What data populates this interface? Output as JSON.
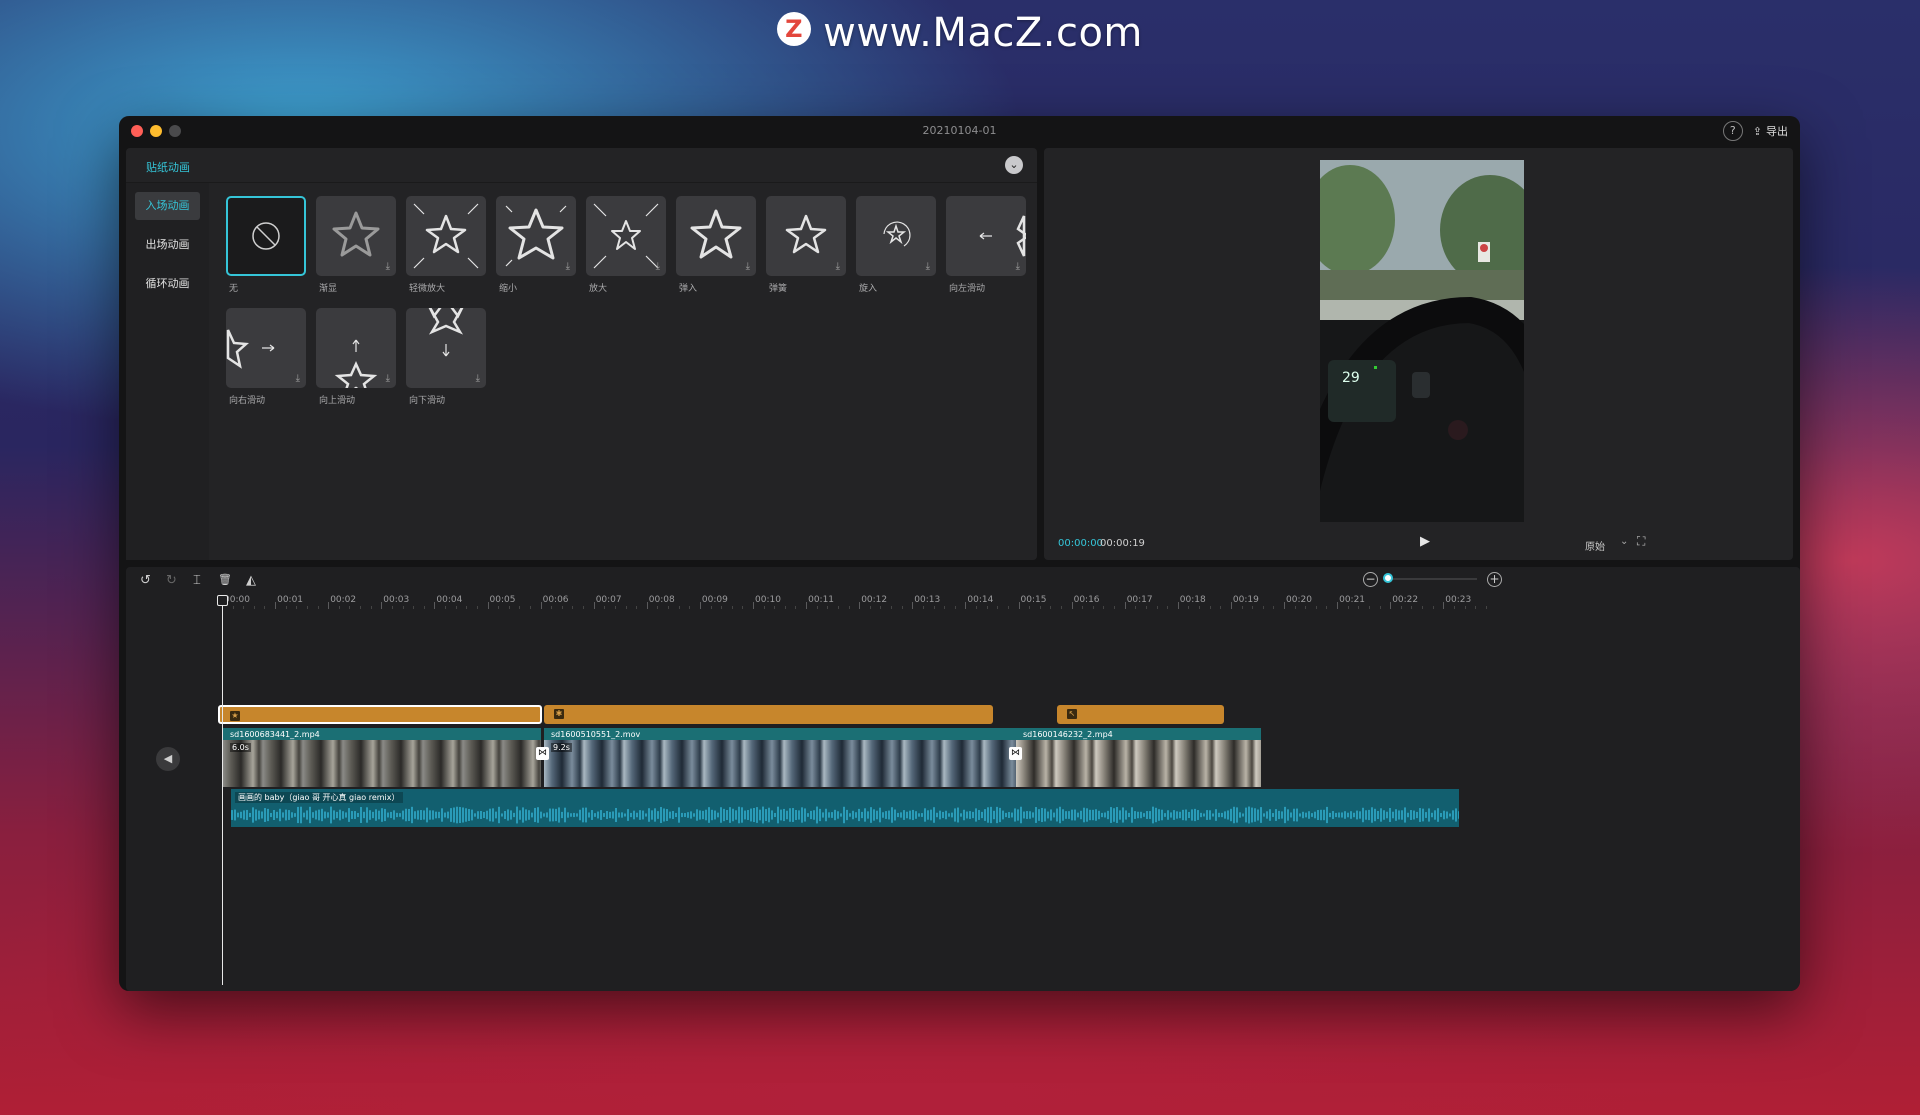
{
  "watermark": {
    "logo": "Z",
    "text": "www.MacZ.com"
  },
  "window": {
    "title": "20210104-01",
    "help_icon": "?",
    "export_icon": "⇪",
    "export_label": "导出",
    "traffic_lights": {
      "close": "#ff5f57",
      "minimize": "#febc2e",
      "zoom": "#555557"
    }
  },
  "animation_panel": {
    "header": "贴纸动画",
    "collapse_icon": "⌄",
    "tabs": [
      "入场动画",
      "出场动画",
      "循环动画"
    ],
    "active_tab": "入场动画",
    "presets": [
      "无",
      "渐显",
      "轻微放大",
      "缩小",
      "放大",
      "弹入",
      "弹簧",
      "旋入",
      "向左滑动",
      "向右滑动",
      "向上滑动",
      "向下滑动"
    ],
    "download_icon": "⤓"
  },
  "preview": {
    "current_time": "00:00:00",
    "total_time": "00:00:19",
    "play_icon": "▶",
    "ratio_label": "原始",
    "ratio_caret": "⌄",
    "fullscreen_icon": "⛶"
  },
  "timeline": {
    "tools": {
      "undo": "↺",
      "redo": "↻",
      "split": "⌶",
      "delete": "🗑",
      "mirror": "◭"
    },
    "zoom_out_icon": "−",
    "zoom_in_icon": "+",
    "ruler": [
      "00:00",
      "00:01",
      "00:02",
      "00:03",
      "00:04",
      "00:05",
      "00:06",
      "00:07",
      "00:08",
      "00:09",
      "00:10",
      "00:11",
      "00:12",
      "00:13",
      "00:14",
      "00:15",
      "00:16",
      "00:17",
      "00:18",
      "00:19",
      "00:20",
      "00:21",
      "00:22",
      "00:23"
    ],
    "sticker_icons": [
      "★",
      "✱",
      "↖"
    ],
    "video_clips": [
      {
        "name": "sd1600683441_2.mp4",
        "duration": "6.0s"
      },
      {
        "name": "sd1600510551_2.mov",
        "duration": "9.2s"
      },
      {
        "name": "sd1600146232_2.mp4",
        "duration": ""
      }
    ],
    "transition_icon": "⋈",
    "audio_clip": {
      "name": "画画的 baby（giao 哥 开心真 giao remix）"
    },
    "mute_icon": "◀"
  }
}
